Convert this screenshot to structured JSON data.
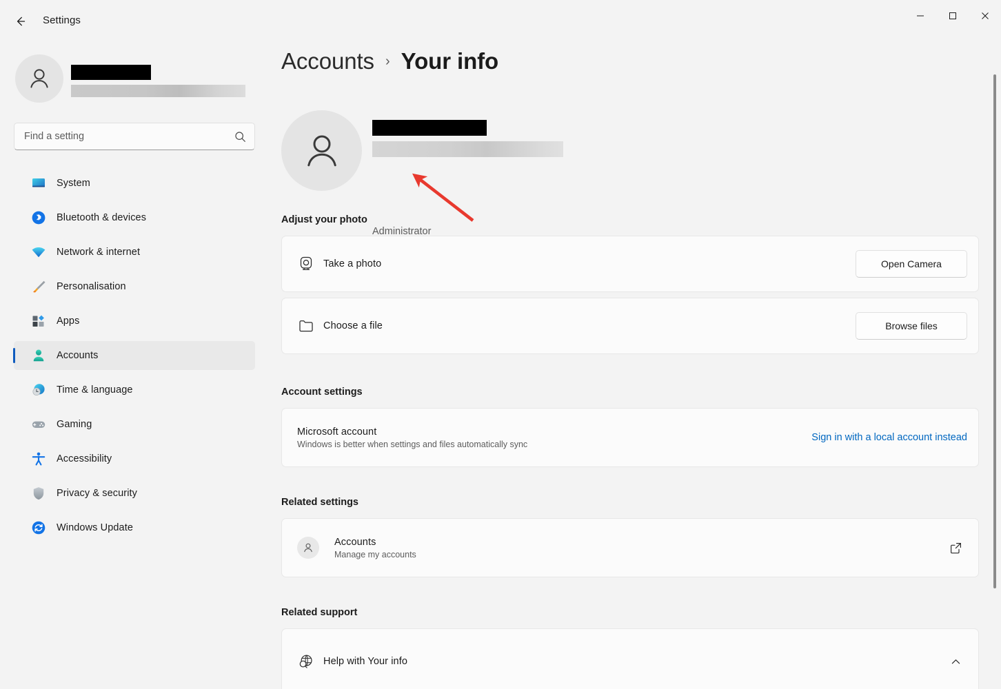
{
  "window": {
    "app_title": "Settings",
    "back_icon": "back-arrow-icon",
    "minimize_label": "—",
    "maximize_label": "□",
    "close_label": "✕"
  },
  "sidebar": {
    "profile": {
      "name_redacted": "",
      "email_redacted": "",
      "avatar_icon": "person-avatar-icon"
    },
    "search": {
      "placeholder": "Find a setting",
      "value": "",
      "icon": "search-icon"
    },
    "items": [
      {
        "label": "System",
        "icon": "system-monitor-icon",
        "selected": false
      },
      {
        "label": "Bluetooth & devices",
        "icon": "bluetooth-icon",
        "selected": false
      },
      {
        "label": "Network & internet",
        "icon": "wifi-icon",
        "selected": false
      },
      {
        "label": "Personalisation",
        "icon": "paintbrush-icon",
        "selected": false
      },
      {
        "label": "Apps",
        "icon": "apps-grid-icon",
        "selected": false
      },
      {
        "label": "Accounts",
        "icon": "person-icon",
        "selected": true
      },
      {
        "label": "Time & language",
        "icon": "clock-globe-icon",
        "selected": false
      },
      {
        "label": "Gaming",
        "icon": "gamepad-icon",
        "selected": false
      },
      {
        "label": "Accessibility",
        "icon": "accessibility-person-icon",
        "selected": false
      },
      {
        "label": "Privacy & security",
        "icon": "shield-icon",
        "selected": false
      },
      {
        "label": "Windows Update",
        "icon": "update-refresh-icon",
        "selected": false
      }
    ]
  },
  "main": {
    "breadcrumb": {
      "parent": "Accounts",
      "separator": "›",
      "current": "Your info"
    },
    "account_hero": {
      "avatar_icon": "person-avatar-icon",
      "name_redacted": "",
      "email_redacted": "",
      "role": "Administrator"
    },
    "adjust_photo": {
      "heading": "Adjust your photo",
      "rows": [
        {
          "title": "Take a photo",
          "icon": "camera-icon",
          "action_label": "Open Camera"
        },
        {
          "title": "Choose a file",
          "icon": "folder-icon",
          "action_label": "Browse files"
        }
      ]
    },
    "account_settings": {
      "heading": "Account settings",
      "row": {
        "title": "Microsoft account",
        "subtitle": "Windows is better when settings and files automatically sync",
        "link_label": "Sign in with a local account instead"
      }
    },
    "related_settings": {
      "heading": "Related settings",
      "row": {
        "title": "Accounts",
        "subtitle": "Manage my accounts",
        "icon": "person-chip-icon",
        "trailing_icon": "external-link-icon"
      }
    },
    "related_support": {
      "heading": "Related support",
      "row": {
        "title": "Help with Your info",
        "icon": "help-globe-icon",
        "trailing_icon": "chevron-up-icon"
      }
    }
  },
  "annotation": {
    "arrow_color": "#e8392e",
    "points_at": "Administrator"
  },
  "colors": {
    "page_background": "#f3f3f3",
    "card_background": "#fbfbfb",
    "accent": "#0067c0",
    "selection_bar": "#0f5bbe",
    "link": "#0067c0",
    "annotation_red": "#e8392e"
  }
}
